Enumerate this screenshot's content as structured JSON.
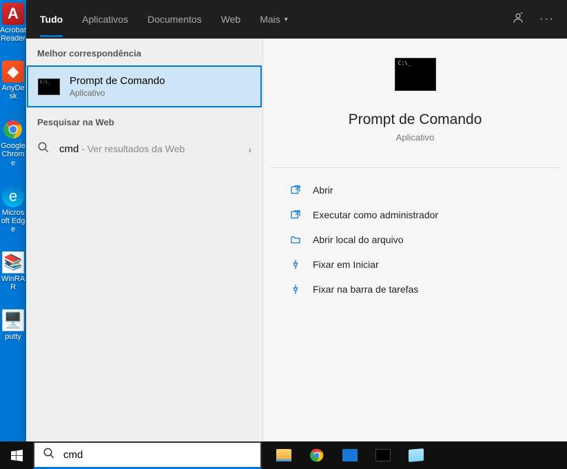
{
  "desktop_icons": [
    {
      "label": "Acrobat Reader"
    },
    {
      "label": "AnyDesk"
    },
    {
      "label": "Google Chrome"
    },
    {
      "label": "Microsoft Edge"
    },
    {
      "label": "WinRAR"
    },
    {
      "label": "putty"
    }
  ],
  "tabs": {
    "tudo": "Tudo",
    "aplicativos": "Aplicativos",
    "documentos": "Documentos",
    "web": "Web",
    "mais": "Mais"
  },
  "left": {
    "best_header": "Melhor correspondência",
    "best_title": "Prompt de Comando",
    "best_sub": "Aplicativo",
    "web_header": "Pesquisar na Web",
    "web_query": "cmd",
    "web_hint": " - Ver resultados da Web"
  },
  "preview": {
    "title": "Prompt de Comando",
    "sub": "Aplicativo"
  },
  "actions": {
    "open": "Abrir",
    "admin": "Executar como administrador",
    "location": "Abrir local do arquivo",
    "pin_start": "Fixar em Iniciar",
    "pin_taskbar": "Fixar na barra de tarefas"
  },
  "search": {
    "value": "cmd"
  }
}
